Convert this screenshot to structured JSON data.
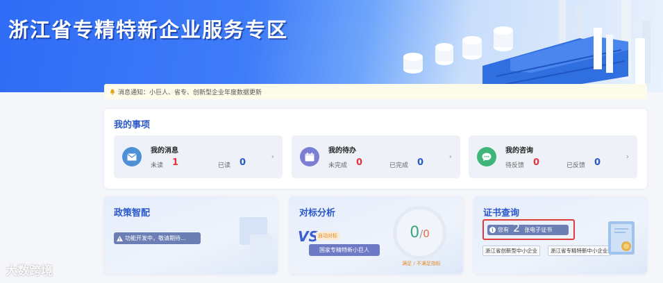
{
  "banner": {
    "title": "浙江省专精特新企业服务专区"
  },
  "notice": {
    "text": "消息通知：小巨人、省专、创新型企业年度数据更新"
  },
  "my_items": {
    "title": "我的事项",
    "items": [
      {
        "name": "我的消息",
        "icon": "mail-icon",
        "stat1_label": "未读",
        "stat1_value": "1",
        "stat2_label": "已读",
        "stat2_value": "0"
      },
      {
        "name": "我的待办",
        "icon": "calendar-icon",
        "stat1_label": "未完成",
        "stat1_value": "0",
        "stat2_label": "已完成",
        "stat2_value": "0"
      },
      {
        "name": "我的咨询",
        "icon": "chat-bubble-icon",
        "stat1_label": "待反馈",
        "stat1_value": "0",
        "stat2_label": "已反馈",
        "stat2_value": "0"
      }
    ]
  },
  "policy": {
    "title": "政策智配",
    "status": "功能开发中，敬请期待..."
  },
  "benchmark": {
    "title": "对标分析",
    "vs_label": "VS",
    "auto_tag": "自动对标",
    "target": "国家专精特新小巨人",
    "met": "0",
    "sep": "/",
    "unmet": "0",
    "caption": "满足 / 不满足指标"
  },
  "certificate": {
    "title": "证书查询",
    "prefix": "您有",
    "count": "2",
    "suffix": "张电子证书",
    "tags": [
      "浙江省创新型中小企业",
      "浙江省专精特新中小企业"
    ]
  },
  "watermark": "大数跨境",
  "colors": {
    "primary": "#2b58c9",
    "accent_red": "#e3353b",
    "banner_blue": "#2f6cf6"
  }
}
